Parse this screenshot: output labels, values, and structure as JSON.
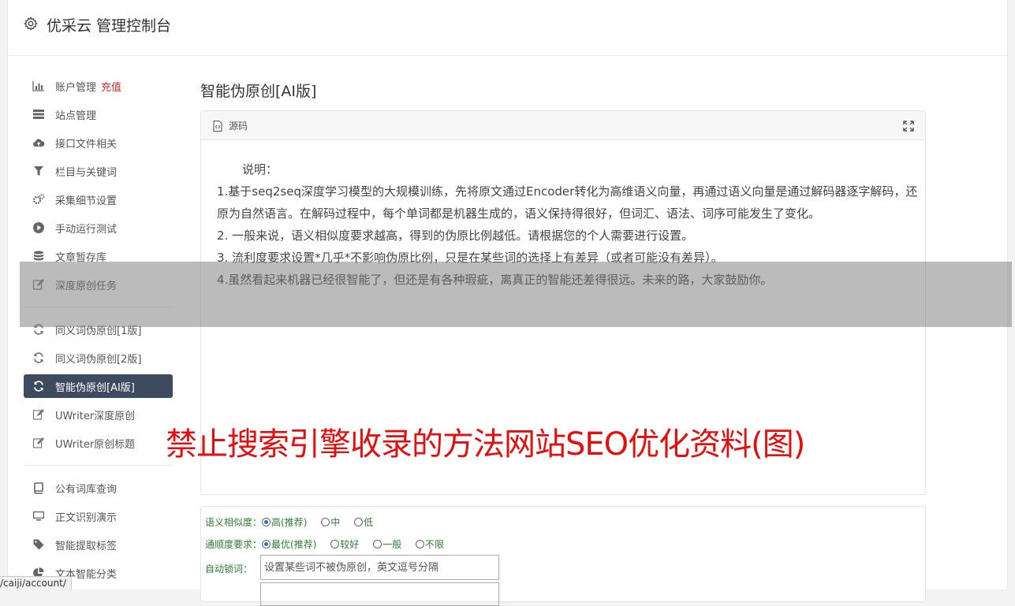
{
  "header": {
    "title": "优采云 管理控制台",
    "icon": "gear-icon"
  },
  "sidebar": {
    "items": [
      {
        "label": "账户管理",
        "badge": "充值",
        "icon": "bar-chart-icon"
      },
      {
        "label": "站点管理",
        "icon": "server-icon"
      },
      {
        "label": "接口文件相关",
        "icon": "cloud-upload-icon"
      },
      {
        "label": "栏目与关键词",
        "icon": "filter-icon"
      },
      {
        "label": "采集细节设置",
        "icon": "cogs-icon"
      },
      {
        "label": "手动运行测试",
        "icon": "play-circle-icon"
      },
      {
        "label": "文章暂存库",
        "icon": "database-icon"
      },
      {
        "label": "深度原创任务",
        "icon": "edit-icon"
      },
      {
        "label": "同义词伪原创[1版]",
        "icon": "refresh-icon"
      },
      {
        "label": "同义词伪原创[2版]",
        "icon": "refresh-icon"
      },
      {
        "label": "智能伪原创[AI版]",
        "icon": "refresh-icon",
        "active": true
      },
      {
        "label": "UWriter深度原创",
        "icon": "edit-icon"
      },
      {
        "label": "UWriter原创标题",
        "icon": "edit-icon"
      },
      {
        "label": "公有词库查询",
        "icon": "book-icon"
      },
      {
        "label": "正文识别演示",
        "icon": "desktop-icon"
      },
      {
        "label": "智能提取标签",
        "icon": "tag-icon"
      },
      {
        "label": "文本智能分类",
        "icon": "pie-chart-icon"
      }
    ]
  },
  "main": {
    "title": "智能伪原创[AI版]",
    "panel": {
      "source_label": "源码",
      "intro": "说明：",
      "lines": [
        "1.基于seq2seq深度学习模型的大规模训练，先将原文通过Encoder转化为高维语义向量，再通过语义向量是通过解码器逐字解码，还原为自然语言。在解码过程中，每个单词都是机器生成的，语义保持得很好，但词汇、语法、词序可能发生了变化。",
        "2. 一般来说，语义相似度要求越高，得到的伪原比例越低。请根据您的个人需要进行设置。",
        "3. 流利度要求设置*几乎*不影响伪原比例，只是在某些词的选择上有差异（或者可能没有差异）。",
        "4.虽然看起来机器已经很智能了，但还是有各种瑕疵，离真正的智能还差得很远。未来的路，大家鼓励你。"
      ]
    },
    "form": {
      "similarity_label": "语义相似度：",
      "similarity_options": [
        "高(推荐)",
        "中",
        "低"
      ],
      "similarity_selected": "高(推荐)",
      "fluency_label": "通顺度要求：",
      "fluency_options": [
        "最优(推荐)",
        "较好",
        "一般",
        "不限"
      ],
      "fluency_selected": "最优(推荐)",
      "lock_label": "自动锁词：",
      "lock_placeholder": "设置某些词不被伪原创，英文逗号分隔"
    }
  },
  "watermark": "禁止搜索引擎收录的方法网站SEO优化资料(图)",
  "status_url": "/caiji/account/"
}
